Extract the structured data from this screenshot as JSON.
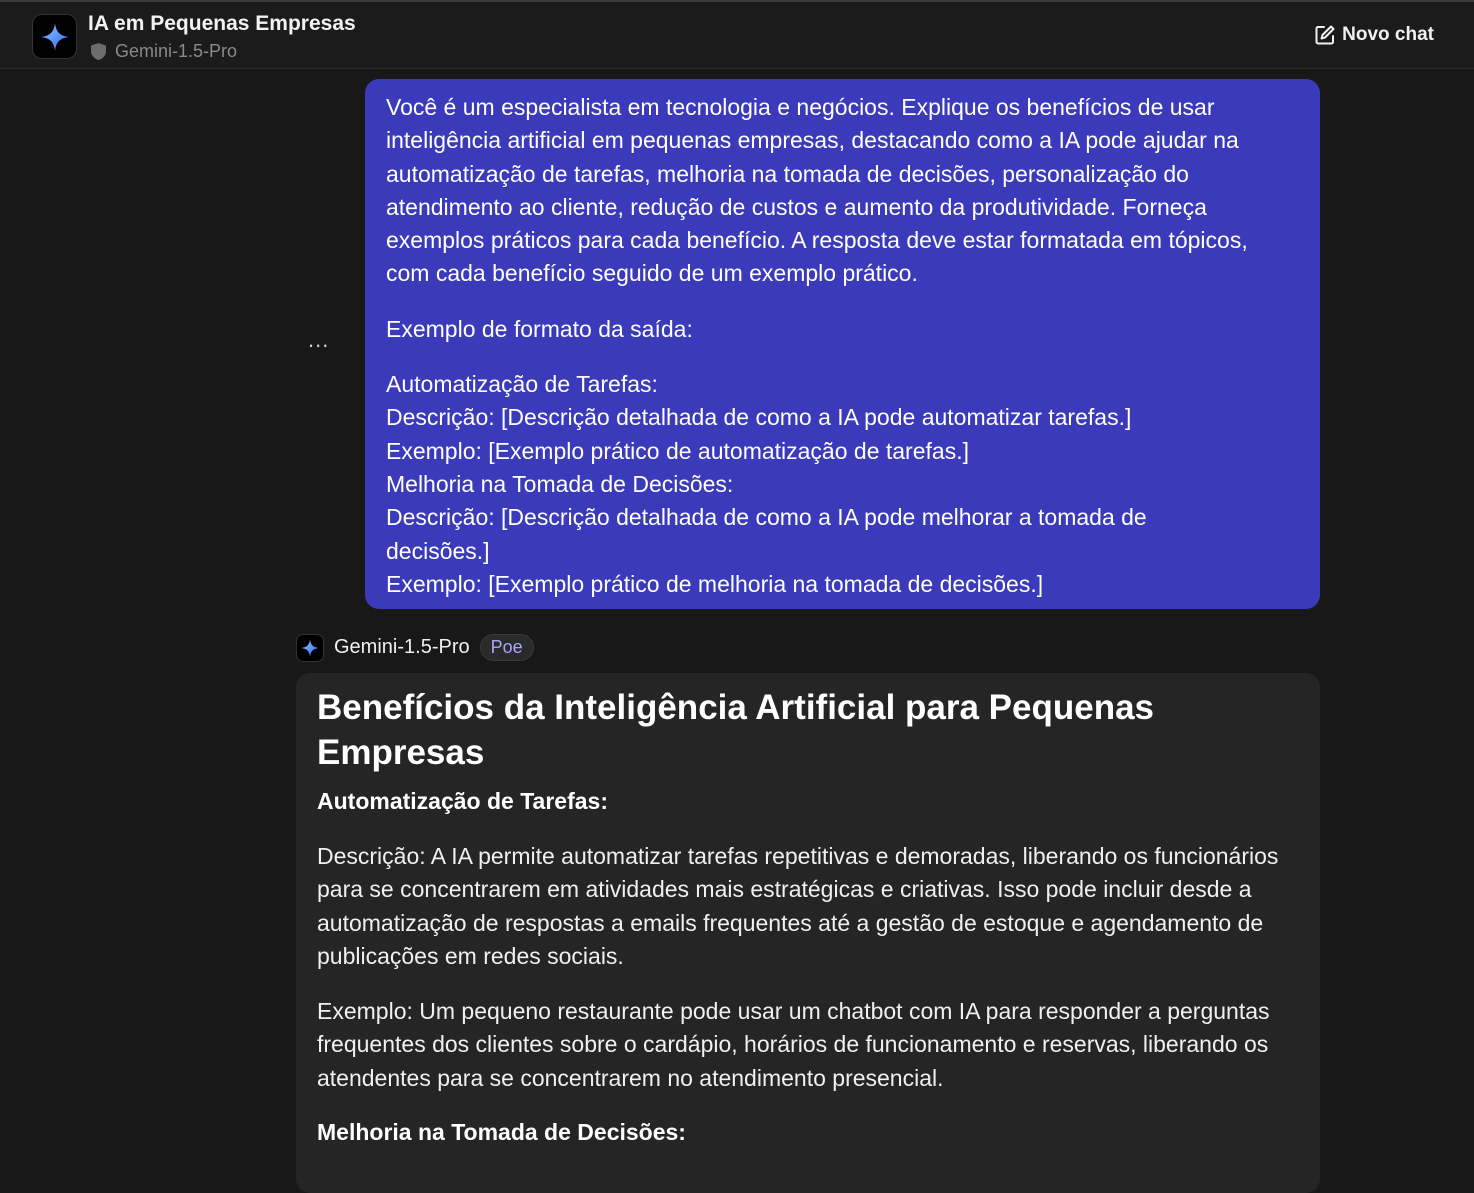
{
  "header": {
    "title": "IA em Pequenas Empresas",
    "bot_name": "Gemini-1.5-Pro",
    "new_chat_label": "Novo chat"
  },
  "user_message": {
    "more_label": "...",
    "paragraphs": [
      [
        "Você é um especialista em tecnologia e negócios. Explique os benefícios de usar",
        "inteligência artificial em pequenas empresas, destacando como a IA pode ajudar na",
        "automatização de tarefas, melhoria na tomada de decisões, personalização do",
        "atendimento ao cliente, redução de custos e aumento da produtividade. Forneça",
        "exemplos práticos para cada benefício. A resposta deve estar formatada em tópicos,",
        "com cada benefício seguido de um exemplo prático."
      ],
      [
        "Exemplo de formato da saída:"
      ],
      [
        "Automatização de Tarefas:",
        "Descrição: [Descrição detalhada de como a IA pode automatizar tarefas.]",
        "Exemplo: [Exemplo prático de automatização de tarefas.]",
        "Melhoria na Tomada de Decisões:",
        "Descrição: [Descrição detalhada de como a IA pode melhorar a tomada de",
        "decisões.]",
        "Exemplo: [Exemplo prático de melhoria na tomada de decisões.]"
      ]
    ]
  },
  "bot_message": {
    "bot_name": "Gemini-1.5-Pro",
    "badge": "Poe",
    "heading": "Benefícios da Inteligência Artificial para Pequenas Empresas",
    "sections": [
      {
        "title": "Automatização de Tarefas:",
        "description": "Descrição: A IA permite automatizar tarefas repetitivas e demoradas, liberando os funcionários para se concentrarem em atividades mais estratégicas e criativas. Isso pode incluir desde a automatização de respostas a emails frequentes até a gestão de estoque e agendamento de publicações em redes sociais.",
        "example": "Exemplo: Um pequeno restaurante pode usar um chatbot com IA para responder a perguntas frequentes dos clientes sobre o cardápio, horários de funcionamento e reservas, liberando os atendentes para se concentrarem no atendimento presencial."
      },
      {
        "title": "Melhoria na Tomada de Decisões:"
      }
    ]
  }
}
